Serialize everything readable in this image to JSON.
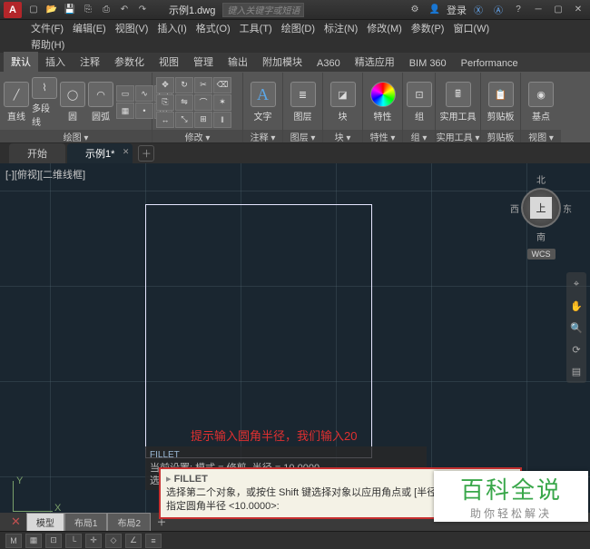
{
  "app_icon_letter": "A",
  "doc_name": "示例1.dwg",
  "search_placeholder": "键入关键字或短语",
  "login_label": "登录",
  "menus": [
    "文件(F)",
    "编辑(E)",
    "视图(V)",
    "插入(I)",
    "格式(O)",
    "工具(T)",
    "绘图(D)",
    "标注(N)",
    "修改(M)",
    "参数(P)",
    "窗口(W)"
  ],
  "menu_help": "帮助(H)",
  "ribbon_tabs": [
    "默认",
    "插入",
    "注释",
    "参数化",
    "视图",
    "管理",
    "输出",
    "附加模块",
    "A360",
    "精选应用",
    "BIM 360",
    "Performance"
  ],
  "panels": {
    "draw_title": "绘图 ▾",
    "modify_title": "修改 ▾",
    "anno_title": "注释 ▾",
    "layer_title": "图层 ▾",
    "block_title": "块 ▾",
    "prop_title": "特性 ▾",
    "group_title": "组 ▾",
    "util_title": "实用工具 ▾",
    "clip_title": "剪贴板",
    "view_title": "视图 ▾"
  },
  "draw_btns": {
    "line": "直线",
    "pline": "多段线",
    "circle": "圆",
    "arc": "圆弧"
  },
  "anno_btn": "文字",
  "anno_sub": "注释",
  "layer_btn": "图层",
  "block_btn": "块",
  "prop_btn": "特性",
  "group_btn": "组",
  "util_btn": "实用工具",
  "clip_btn": "剪贴板",
  "base_btn": "基点",
  "filetabs": {
    "start": "开始",
    "doc": "示例1*"
  },
  "vp_label": "[-][俯视][二维线框]",
  "viewcube": {
    "n": "北",
    "s": "南",
    "e": "东",
    "w": "西",
    "face": "上",
    "wcs": "WCS"
  },
  "annotation_text": "提示输入圆角半径，我们输入20",
  "cmd_inline": {
    "name": "FILLET",
    "l1": "当前设置: 模式 = 修剪, 半径 = 10.0000",
    "l2": "选择第一个对象或 [放弃(U)/多段线(P)/半径(R)/修剪(T)/多个"
  },
  "cmd_float": {
    "name": "FILLET",
    "l1": "选择第二个对象，或按住 Shift 键选择对象以应用角点或 [半径",
    "l2": "指定圆角半径 <10.0000>:"
  },
  "ucs": {
    "y": "Y",
    "x": "X"
  },
  "layout_tabs": {
    "model": "模型",
    "l1": "布局1",
    "l2": "布局2"
  },
  "brand": {
    "big": "百科全说",
    "small": "助你轻松解决"
  }
}
